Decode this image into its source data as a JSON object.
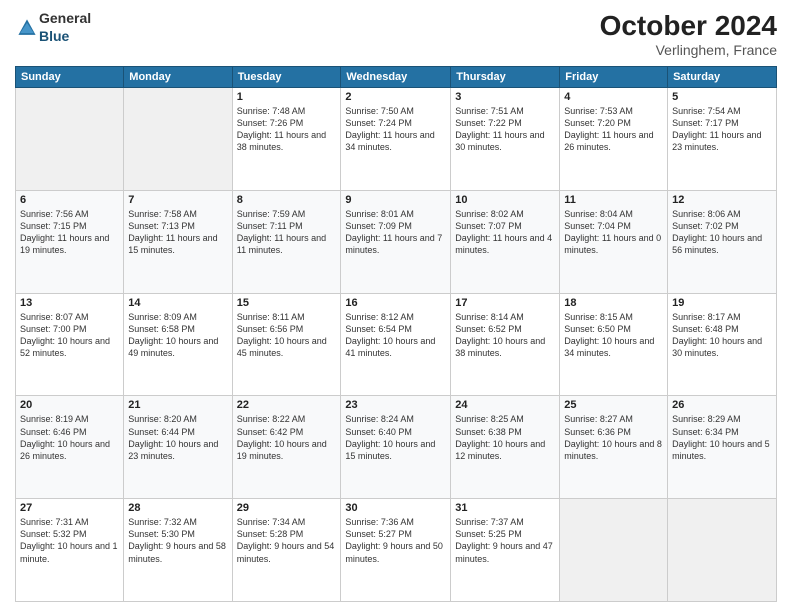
{
  "header": {
    "logo_general": "General",
    "logo_blue": "Blue",
    "month": "October 2024",
    "location": "Verlinghem, France"
  },
  "weekdays": [
    "Sunday",
    "Monday",
    "Tuesday",
    "Wednesday",
    "Thursday",
    "Friday",
    "Saturday"
  ],
  "weeks": [
    [
      {
        "day": "",
        "info": ""
      },
      {
        "day": "",
        "info": ""
      },
      {
        "day": "1",
        "info": "Sunrise: 7:48 AM\nSunset: 7:26 PM\nDaylight: 11 hours and 38 minutes."
      },
      {
        "day": "2",
        "info": "Sunrise: 7:50 AM\nSunset: 7:24 PM\nDaylight: 11 hours and 34 minutes."
      },
      {
        "day": "3",
        "info": "Sunrise: 7:51 AM\nSunset: 7:22 PM\nDaylight: 11 hours and 30 minutes."
      },
      {
        "day": "4",
        "info": "Sunrise: 7:53 AM\nSunset: 7:20 PM\nDaylight: 11 hours and 26 minutes."
      },
      {
        "day": "5",
        "info": "Sunrise: 7:54 AM\nSunset: 7:17 PM\nDaylight: 11 hours and 23 minutes."
      }
    ],
    [
      {
        "day": "6",
        "info": "Sunrise: 7:56 AM\nSunset: 7:15 PM\nDaylight: 11 hours and 19 minutes."
      },
      {
        "day": "7",
        "info": "Sunrise: 7:58 AM\nSunset: 7:13 PM\nDaylight: 11 hours and 15 minutes."
      },
      {
        "day": "8",
        "info": "Sunrise: 7:59 AM\nSunset: 7:11 PM\nDaylight: 11 hours and 11 minutes."
      },
      {
        "day": "9",
        "info": "Sunrise: 8:01 AM\nSunset: 7:09 PM\nDaylight: 11 hours and 7 minutes."
      },
      {
        "day": "10",
        "info": "Sunrise: 8:02 AM\nSunset: 7:07 PM\nDaylight: 11 hours and 4 minutes."
      },
      {
        "day": "11",
        "info": "Sunrise: 8:04 AM\nSunset: 7:04 PM\nDaylight: 11 hours and 0 minutes."
      },
      {
        "day": "12",
        "info": "Sunrise: 8:06 AM\nSunset: 7:02 PM\nDaylight: 10 hours and 56 minutes."
      }
    ],
    [
      {
        "day": "13",
        "info": "Sunrise: 8:07 AM\nSunset: 7:00 PM\nDaylight: 10 hours and 52 minutes."
      },
      {
        "day": "14",
        "info": "Sunrise: 8:09 AM\nSunset: 6:58 PM\nDaylight: 10 hours and 49 minutes."
      },
      {
        "day": "15",
        "info": "Sunrise: 8:11 AM\nSunset: 6:56 PM\nDaylight: 10 hours and 45 minutes."
      },
      {
        "day": "16",
        "info": "Sunrise: 8:12 AM\nSunset: 6:54 PM\nDaylight: 10 hours and 41 minutes."
      },
      {
        "day": "17",
        "info": "Sunrise: 8:14 AM\nSunset: 6:52 PM\nDaylight: 10 hours and 38 minutes."
      },
      {
        "day": "18",
        "info": "Sunrise: 8:15 AM\nSunset: 6:50 PM\nDaylight: 10 hours and 34 minutes."
      },
      {
        "day": "19",
        "info": "Sunrise: 8:17 AM\nSunset: 6:48 PM\nDaylight: 10 hours and 30 minutes."
      }
    ],
    [
      {
        "day": "20",
        "info": "Sunrise: 8:19 AM\nSunset: 6:46 PM\nDaylight: 10 hours and 26 minutes."
      },
      {
        "day": "21",
        "info": "Sunrise: 8:20 AM\nSunset: 6:44 PM\nDaylight: 10 hours and 23 minutes."
      },
      {
        "day": "22",
        "info": "Sunrise: 8:22 AM\nSunset: 6:42 PM\nDaylight: 10 hours and 19 minutes."
      },
      {
        "day": "23",
        "info": "Sunrise: 8:24 AM\nSunset: 6:40 PM\nDaylight: 10 hours and 15 minutes."
      },
      {
        "day": "24",
        "info": "Sunrise: 8:25 AM\nSunset: 6:38 PM\nDaylight: 10 hours and 12 minutes."
      },
      {
        "day": "25",
        "info": "Sunrise: 8:27 AM\nSunset: 6:36 PM\nDaylight: 10 hours and 8 minutes."
      },
      {
        "day": "26",
        "info": "Sunrise: 8:29 AM\nSunset: 6:34 PM\nDaylight: 10 hours and 5 minutes."
      }
    ],
    [
      {
        "day": "27",
        "info": "Sunrise: 7:31 AM\nSunset: 5:32 PM\nDaylight: 10 hours and 1 minute."
      },
      {
        "day": "28",
        "info": "Sunrise: 7:32 AM\nSunset: 5:30 PM\nDaylight: 9 hours and 58 minutes."
      },
      {
        "day": "29",
        "info": "Sunrise: 7:34 AM\nSunset: 5:28 PM\nDaylight: 9 hours and 54 minutes."
      },
      {
        "day": "30",
        "info": "Sunrise: 7:36 AM\nSunset: 5:27 PM\nDaylight: 9 hours and 50 minutes."
      },
      {
        "day": "31",
        "info": "Sunrise: 7:37 AM\nSunset: 5:25 PM\nDaylight: 9 hours and 47 minutes."
      },
      {
        "day": "",
        "info": ""
      },
      {
        "day": "",
        "info": ""
      }
    ]
  ]
}
